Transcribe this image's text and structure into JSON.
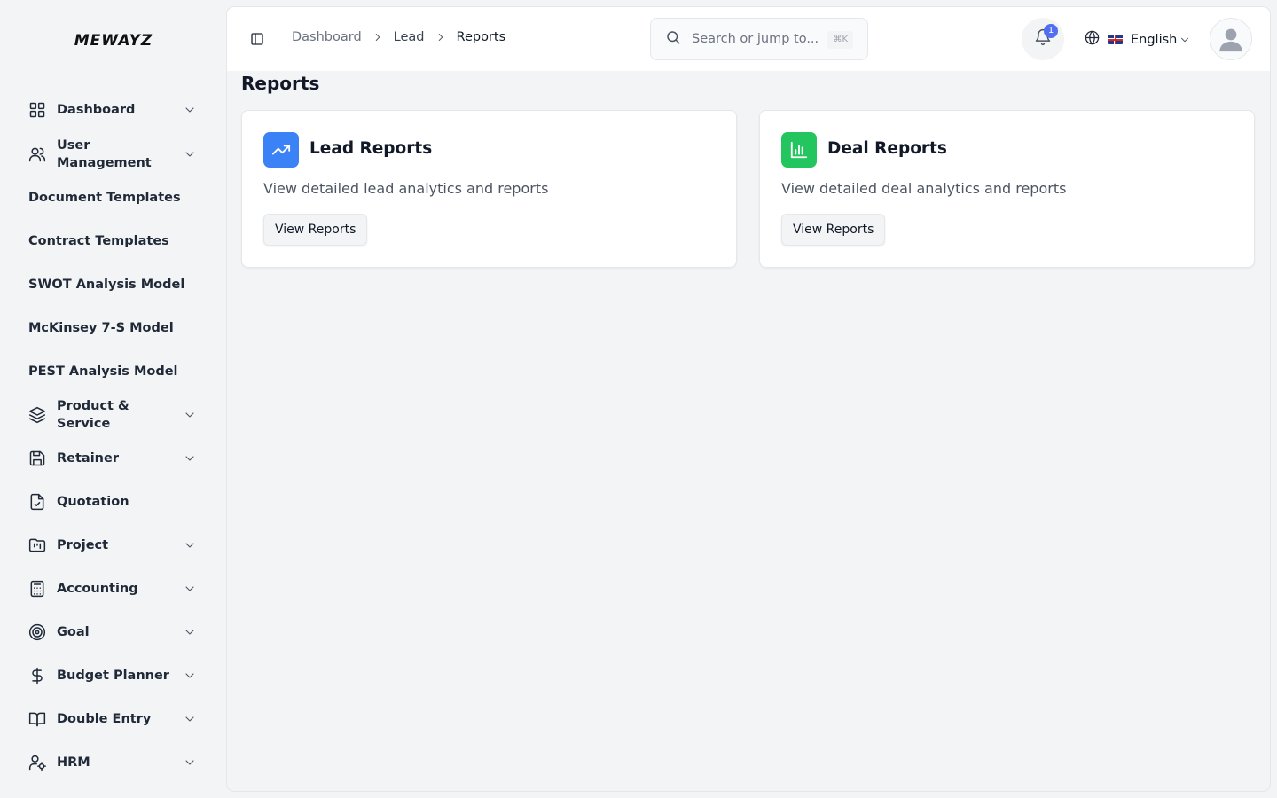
{
  "app": {
    "logo": "MEWAYZ"
  },
  "sidebar": {
    "items": [
      {
        "label": "Dashboard",
        "icon": "grid-icon",
        "has_chevron": true
      },
      {
        "label": "User Management",
        "icon": "users-icon",
        "has_chevron": true
      },
      {
        "label": "Document Templates",
        "icon": "",
        "has_chevron": false
      },
      {
        "label": "Contract Templates",
        "icon": "",
        "has_chevron": false
      },
      {
        "label": "SWOT Analysis Model",
        "icon": "",
        "has_chevron": false
      },
      {
        "label": "McKinsey 7-S Model",
        "icon": "",
        "has_chevron": false
      },
      {
        "label": "PEST Analysis Model",
        "icon": "",
        "has_chevron": false
      },
      {
        "label": "Product & Service",
        "icon": "layers-icon",
        "has_chevron": true
      },
      {
        "label": "Retainer",
        "icon": "save-icon",
        "has_chevron": true
      },
      {
        "label": "Quotation",
        "icon": "file-check-icon",
        "has_chevron": false
      },
      {
        "label": "Project",
        "icon": "folder-kanban-icon",
        "has_chevron": true
      },
      {
        "label": "Accounting",
        "icon": "calculator-icon",
        "has_chevron": true
      },
      {
        "label": "Goal",
        "icon": "target-icon",
        "has_chevron": true
      },
      {
        "label": "Budget Planner",
        "icon": "dollar-icon",
        "has_chevron": true
      },
      {
        "label": "Double Entry",
        "icon": "book-open-icon",
        "has_chevron": true
      },
      {
        "label": "HRM",
        "icon": "user-cog-icon",
        "has_chevron": true
      }
    ]
  },
  "header": {
    "breadcrumb": [
      "Dashboard",
      "Lead",
      "Reports"
    ],
    "search": {
      "placeholder": "Search or jump to...",
      "shortcut": "⌘K"
    },
    "notifications": {
      "count": "1"
    },
    "language": {
      "label": "English"
    }
  },
  "page": {
    "title": "Reports",
    "cards": [
      {
        "title": "Lead Reports",
        "description": "View detailed lead analytics and reports",
        "button": "View Reports",
        "icon": "trending-up-icon",
        "color": "#3b82f6"
      },
      {
        "title": "Deal Reports",
        "description": "View detailed deal analytics and reports",
        "button": "View Reports",
        "icon": "bar-chart-icon",
        "color": "#22c55e"
      }
    ]
  }
}
